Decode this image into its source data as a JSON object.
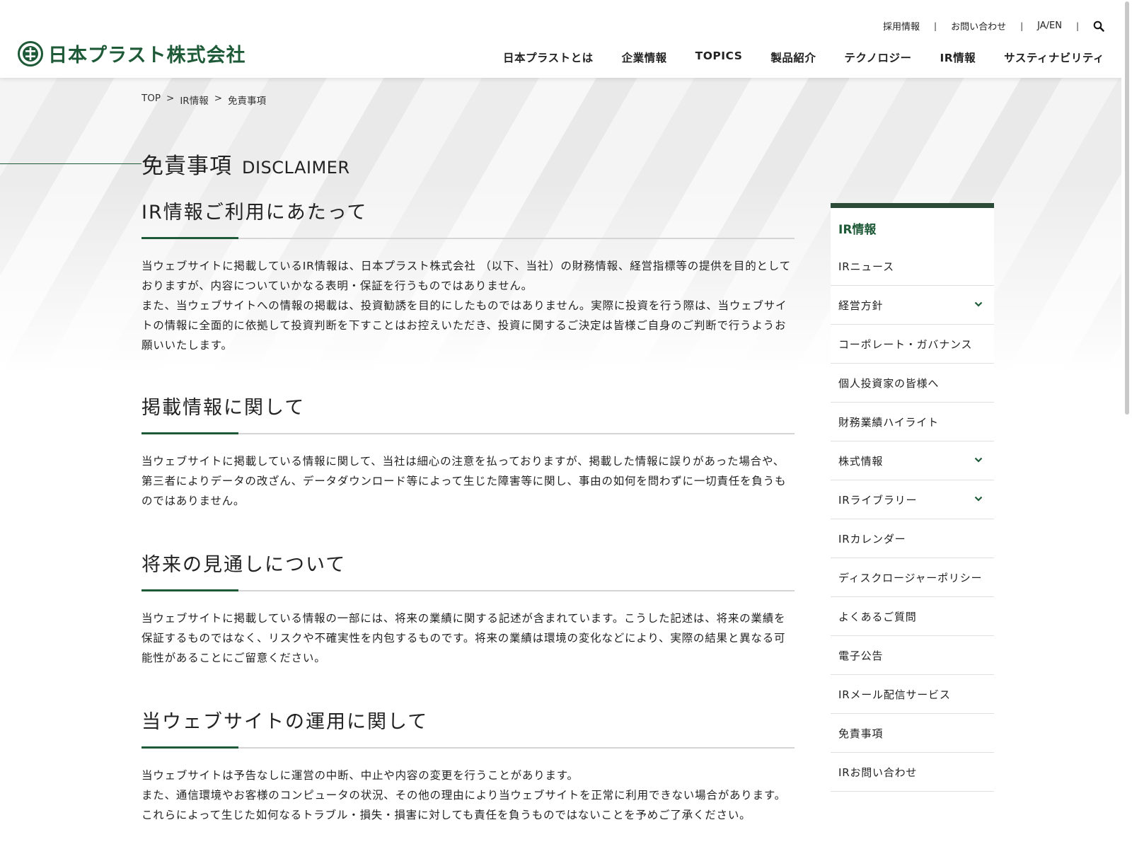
{
  "header": {
    "logo_text": "日本プラスト株式会社",
    "util_links": [
      "採用情報",
      "お問い合わせ",
      "JA/EN"
    ],
    "nav": [
      "日本プラストとは",
      "企業情報",
      "TOPICS",
      "製品紹介",
      "テクノロジー",
      "IR情報",
      "サスティナビリティ"
    ]
  },
  "breadcrumb": {
    "items": [
      "TOP",
      "IR情報",
      "免責事項"
    ],
    "separator": ">"
  },
  "page_title": {
    "jp": "免責事項",
    "en": "DISCLAIMER"
  },
  "sections": [
    {
      "heading": "IR情報ご利用にあたって",
      "paragraphs": [
        "当ウェブサイトに掲載しているIR情報は、日本プラスト株式会社 （以下、当社）の財務情報、経営指標等の提供を目的としておりますが、内容についていかなる表明・保証を行うものではありません。",
        "また、当ウェブサイトへの情報の掲載は、投資勧誘を目的にしたものではありません。実際に投資を行う際は、当ウェブサイトの情報に全面的に依拠して投資判断を下すことはお控えいただき、投資に関するご決定は皆様ご自身のご判断で行うようお願いいたします。"
      ]
    },
    {
      "heading": "掲載情報に関して",
      "paragraphs": [
        "当ウェブサイトに掲載している情報に関して、当社は細心の注意を払っておりますが、掲載した情報に誤りがあった場合や、第三者によりデータの改ざん、データダウンロード等によって生じた障害等に関し、事由の如何を問わずに一切責任を負うものではありません。"
      ]
    },
    {
      "heading": "将来の見通しについて",
      "paragraphs": [
        "当ウェブサイトに掲載している情報の一部には、将来の業績に関する記述が含まれています。こうした記述は、将来の業績を保証するものではなく、リスクや不確実性を内包するものです。将来の業績は環境の変化などにより、実際の結果と異なる可能性があることにご留意ください。"
      ]
    },
    {
      "heading": "当ウェブサイトの運用に関して",
      "paragraphs": [
        "当ウェブサイトは予告なしに運営の中断、中止や内容の変更を行うことがあります。",
        "また、通信環境やお客様のコンピュータの状況、その他の理由により当ウェブサイトを正常に利用できない場合があります。これらによって生じた如何なるトラブル・損失・損害に対しても責任を負うものではないことを予めご了承ください。"
      ]
    }
  ],
  "sidebar": {
    "title": "IR情報",
    "items": [
      {
        "label": "IRニュース",
        "expandable": false
      },
      {
        "label": "経営方針",
        "expandable": true
      },
      {
        "label": "コーポレート・ガバナンス",
        "expandable": false
      },
      {
        "label": "個人投資家の皆様へ",
        "expandable": false
      },
      {
        "label": "財務業績ハイライト",
        "expandable": false
      },
      {
        "label": "株式情報",
        "expandable": true
      },
      {
        "label": "IRライブラリー",
        "expandable": true
      },
      {
        "label": "IRカレンダー",
        "expandable": false
      },
      {
        "label": "ディスクロージャーポリシー",
        "expandable": false
      },
      {
        "label": "よくあるご質問",
        "expandable": false
      },
      {
        "label": "電子公告",
        "expandable": false
      },
      {
        "label": "IRメール配信サービス",
        "expandable": false
      },
      {
        "label": "免責事項",
        "expandable": false
      },
      {
        "label": "IRお問い合わせ",
        "expandable": false
      }
    ]
  },
  "colors": {
    "brand_green": "#1e5a37",
    "sidebar_bar": "#2c4a38"
  },
  "icons": {
    "logo_mark": "company-logo-mark",
    "search": "search-icon",
    "chevron": "chevron-down-icon"
  }
}
